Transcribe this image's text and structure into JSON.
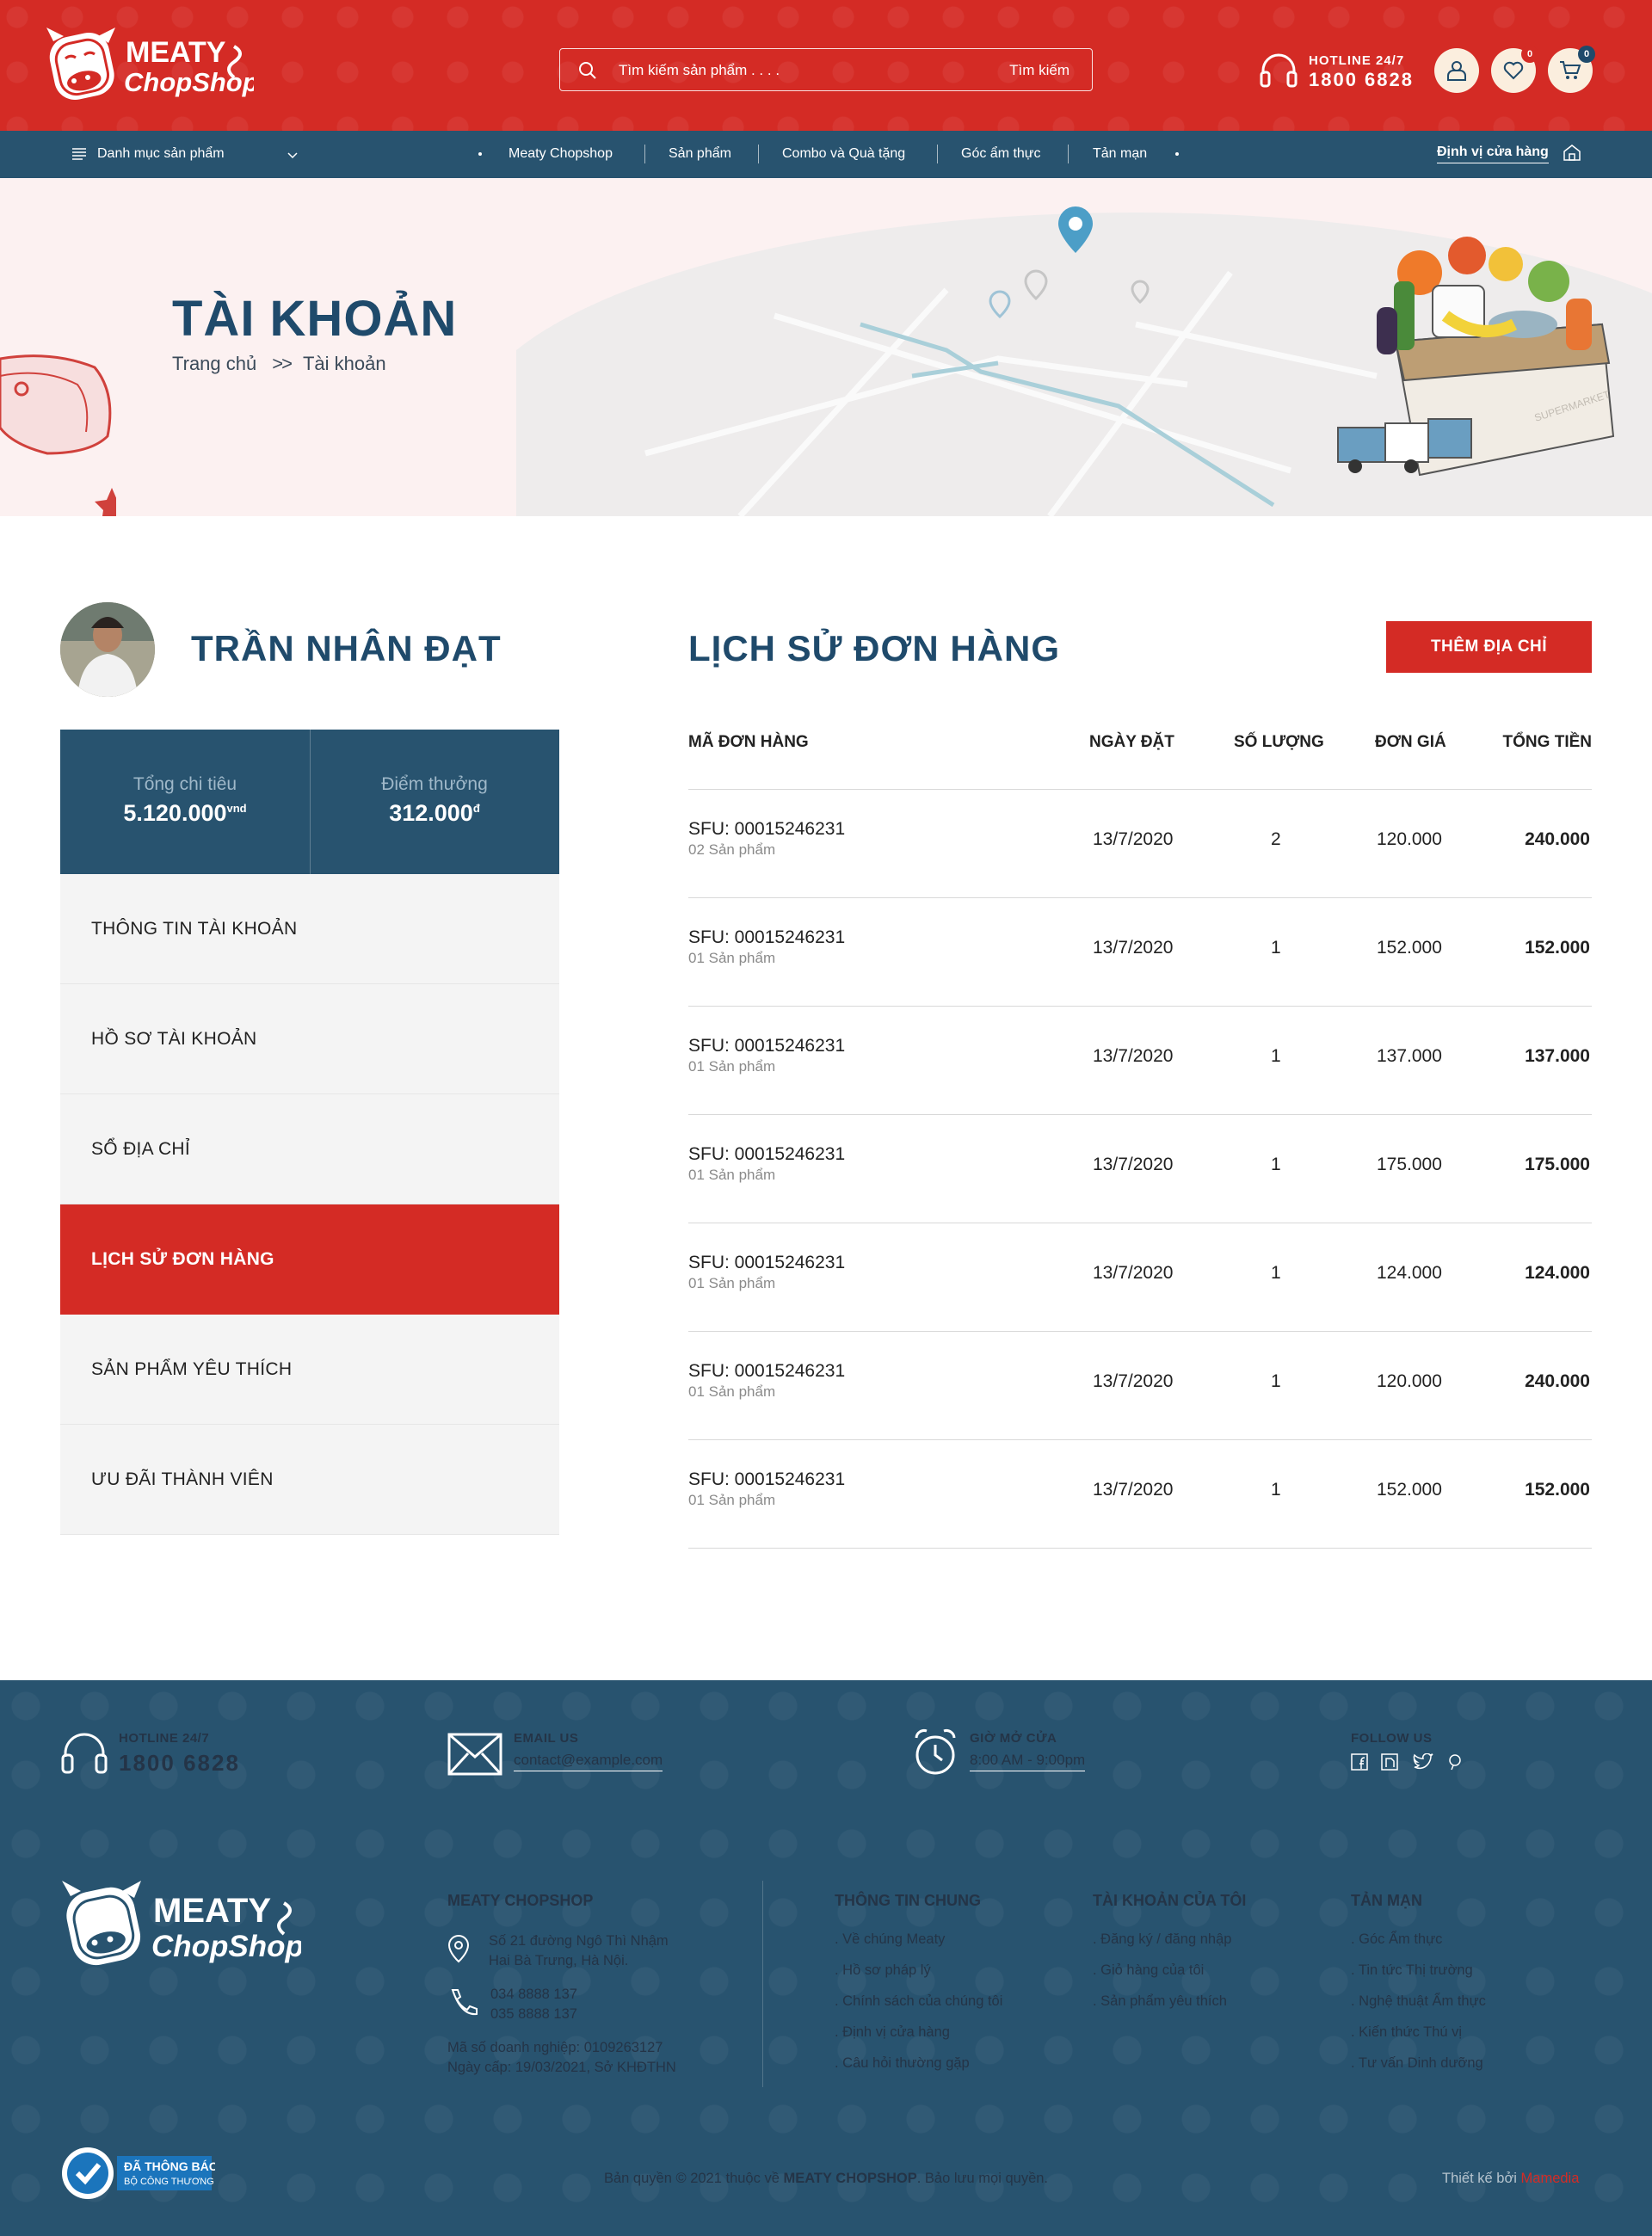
{
  "header": {
    "logo_line1": "MEATY",
    "logo_line2": "ChopShop",
    "search_placeholder": "Tìm kiếm sản phẩm . . . .",
    "search_button": "Tìm kiếm",
    "hotline_label": "HOTLINE 24/7",
    "hotline_number": "1800 6828",
    "wishlist_count": "0",
    "cart_count": "0",
    "accent_color": "#d42b25"
  },
  "nav": {
    "category_label": "Danh mục sản phẩm",
    "items": [
      "Meaty Chopshop",
      "Sản phẩm",
      "Combo và Quà tặng",
      "Góc ẩm thực",
      "Tản mạn"
    ],
    "locate_label": "Định vị cửa hàng",
    "bg_color": "#28536f"
  },
  "hero": {
    "title": "TÀI KHOẢN",
    "breadcrumb_home": "Trang chủ",
    "breadcrumb_sep": ">>",
    "breadcrumb_current": "Tài khoản",
    "box_label": "SUPERMARKET"
  },
  "profile": {
    "name": "TRẦN NHÂN ĐẠT",
    "total_spent_label": "Tổng chi tiêu",
    "total_spent_value": "5.120.000",
    "total_spent_unit": "vnd",
    "points_label": "Điểm thưởng",
    "points_value": "312.000",
    "points_unit": "đ",
    "menu": [
      {
        "label": "THÔNG TIN TÀI KHOẢN",
        "active": false
      },
      {
        "label": "HỒ SƠ TÀI KHOẢN",
        "active": false
      },
      {
        "label": "SỔ ĐỊA CHỈ",
        "active": false
      },
      {
        "label": "LỊCH SỬ ĐƠN HÀNG",
        "active": true
      },
      {
        "label": "SẢN PHẨM YÊU THÍCH",
        "active": false
      },
      {
        "label": "ƯU ĐÃI THÀNH VIÊN",
        "active": false
      }
    ]
  },
  "orders": {
    "title": "LỊCH SỬ ĐƠN HÀNG",
    "add_button": "THÊM ĐỊA CHỈ",
    "columns": [
      "MÃ ĐƠN HÀNG",
      "NGÀY ĐẶT",
      "SỐ LƯỢNG",
      "ĐƠN GIÁ",
      "TỔNG TIỀN"
    ],
    "rows": [
      {
        "code": "SFU: 00015246231",
        "items": "02 Sản phẩm",
        "date": "13/7/2020",
        "qty": "2",
        "price": "120.000",
        "total": "240.000"
      },
      {
        "code": "SFU: 00015246231",
        "items": "01 Sản phẩm",
        "date": "13/7/2020",
        "qty": "1",
        "price": "152.000",
        "total": "152.000"
      },
      {
        "code": "SFU: 00015246231",
        "items": "01 Sản phẩm",
        "date": "13/7/2020",
        "qty": "1",
        "price": "137.000",
        "total": "137.000"
      },
      {
        "code": "SFU: 00015246231",
        "items": "01 Sản phẩm",
        "date": "13/7/2020",
        "qty": "1",
        "price": "175.000",
        "total": "175.000"
      },
      {
        "code": "SFU: 00015246231",
        "items": "01 Sản phẩm",
        "date": "13/7/2020",
        "qty": "1",
        "price": "124.000",
        "total": "124.000"
      },
      {
        "code": "SFU: 00015246231",
        "items": "01 Sản phẩm",
        "date": "13/7/2020",
        "qty": "1",
        "price": "120.000",
        "total": "240.000"
      },
      {
        "code": "SFU: 00015246231",
        "items": "01 Sản phẩm",
        "date": "13/7/2020",
        "qty": "1",
        "price": "152.000",
        "total": "152.000"
      }
    ]
  },
  "footer": {
    "hotline_label": "HOTLINE 24/7",
    "hotline_number": "1800 6828",
    "email_label": "EMAIL US",
    "email_value": "contact@example.com",
    "hours_label": "GIỜ MỞ CỬA",
    "hours_value": "8:00 AM  -  9:00pm",
    "follow_label": "FOLLOW US",
    "company_heading": "MEATY CHOPSHOP",
    "address_line1": "Số 21 đường Ngô Thì Nhậm",
    "address_line2": "Hai Bà Trưng, Hà Nội.",
    "phone1": "034 8888 137",
    "phone2": "035 8888 137",
    "tax_line1": "Mã số doanh nghiệp: 0109263127",
    "tax_line2": "Ngày cấp: 19/03/2021, Sở KHĐTHN",
    "col_info": {
      "heading": "THÔNG TIN CHUNG",
      "links": [
        "Về chúng Meaty",
        "Hồ sơ pháp lý",
        "Chính sách của chúng tôi",
        "Định vị cửa hàng",
        "Câu hỏi thường gặp"
      ]
    },
    "col_account": {
      "heading": "TÀI KHOẢN CỦA TÔI",
      "links": [
        "Đăng ký / đăng nhập",
        "Giỏ hàng của tôi",
        "Sản phẩm yêu thích"
      ]
    },
    "col_misc": {
      "heading": "TẢN MẠN",
      "links": [
        "Góc Ẩm thực",
        "Tin tức Thị trường",
        "Nghệ thuật Ẩm thực",
        "Kiến thức Thú vị",
        "Tư vấn Dinh dưỡng"
      ]
    },
    "cert_line1": "ĐÃ THÔNG BÁO",
    "cert_line2": "BỘ CÔNG THƯƠNG",
    "copyright_prefix": "Bản quyền © 2021 thuộc về ",
    "copyright_brand": "MEATY CHOPSHOP",
    "copyright_suffix": ". Bảo lưu mọi quyền.",
    "designed_by": "Thiết kế bởi ",
    "designer": "Mamedia"
  }
}
